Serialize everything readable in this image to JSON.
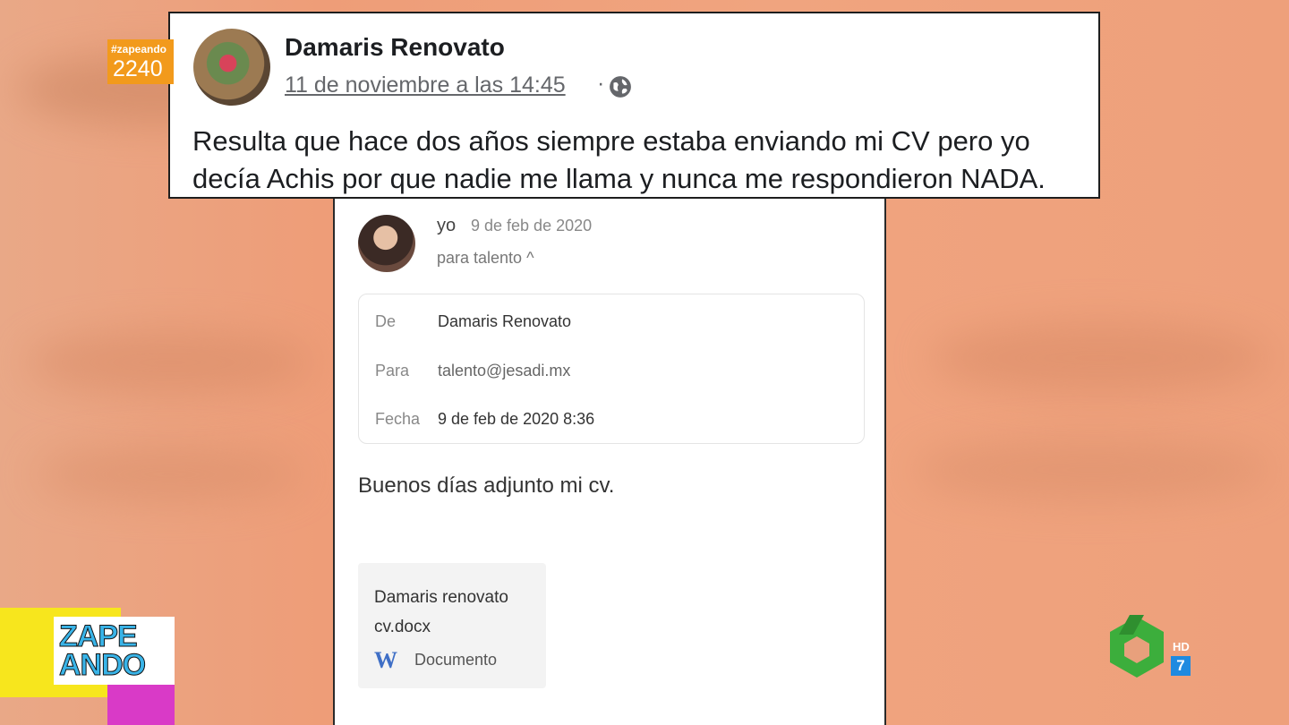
{
  "badge": {
    "tag": "#zapeando",
    "number": "2240"
  },
  "post": {
    "author": "Damaris Renovato",
    "timestamp": "11 de noviembre a las 14:45",
    "separator": "·",
    "text": "Resulta que hace dos años siempre estaba enviando mi CV pero yo decía Achis por que nadie me llama y nunca me respondieron NADA."
  },
  "email": {
    "sender": "yo",
    "date": "9 de feb de 2020",
    "to_line": "para talento ^",
    "details": {
      "from_label": "De",
      "from_value": "Damaris Renovato",
      "to_label": "Para",
      "to_value": "talento@jesadi.mx",
      "date_label": "Fecha",
      "date_value": "9 de feb de 2020 8:36"
    },
    "body": "Buenos días adjunto mi cv.",
    "attachment": {
      "name": "Damaris renovato cv.docx",
      "type_icon": "W",
      "type": "Documento"
    }
  },
  "logo": {
    "text_line1": "ZAPE",
    "text_line2": "ANDO"
  },
  "channel": {
    "hd": "HD",
    "number": "7"
  },
  "colors": {
    "badge": "#f29a1c",
    "logo_yellow": "#f7e61d",
    "logo_pink": "#d93ac7",
    "logo_text": "#39b4e8",
    "sexta_green": "#3cae3c",
    "word_blue": "#3f6fc6"
  }
}
